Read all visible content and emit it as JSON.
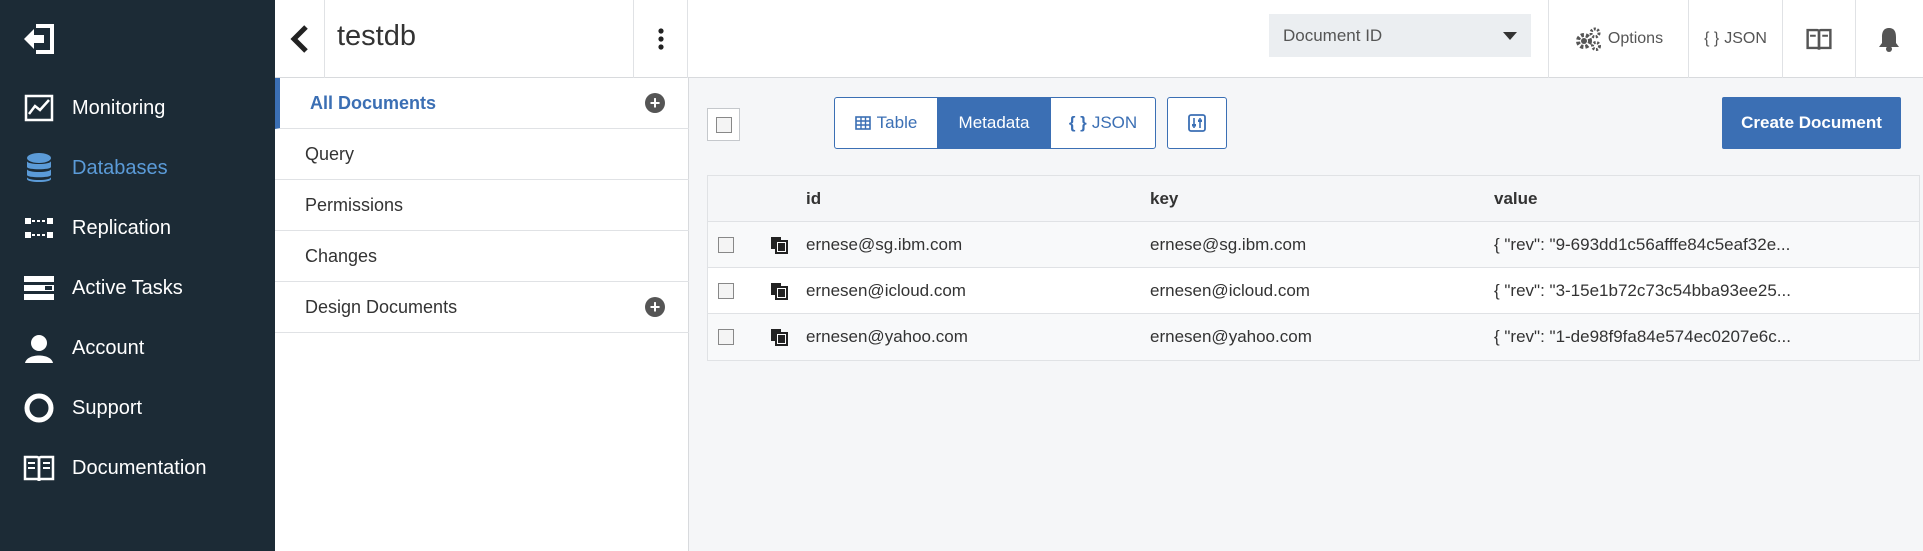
{
  "nav": {
    "items": [
      {
        "label": "Monitoring",
        "icon": "monitoring-icon"
      },
      {
        "label": "Databases",
        "icon": "database-icon",
        "active": true
      },
      {
        "label": "Replication",
        "icon": "replication-icon"
      },
      {
        "label": "Active Tasks",
        "icon": "tasks-icon"
      },
      {
        "label": "Account",
        "icon": "user-icon"
      },
      {
        "label": "Support",
        "icon": "lifebuoy-icon"
      },
      {
        "label": "Documentation",
        "icon": "book-icon"
      }
    ]
  },
  "header": {
    "title": "testdb",
    "select_value": "Document ID",
    "options_label": "Options",
    "json_label": "JSON"
  },
  "sidebar": {
    "items": [
      {
        "label": "All Documents",
        "active": true,
        "plus": true
      },
      {
        "label": "Query"
      },
      {
        "label": "Permissions"
      },
      {
        "label": "Changes"
      },
      {
        "label": "Design Documents",
        "plus": true
      }
    ]
  },
  "toolbar": {
    "views": [
      "Table",
      "Metadata",
      "JSON"
    ],
    "active_view": "Metadata",
    "create_label": "Create Document"
  },
  "table": {
    "columns": [
      "id",
      "key",
      "value"
    ],
    "rows": [
      {
        "id": "ernese@sg.ibm.com",
        "key": "ernese@sg.ibm.com",
        "value": "{ \"rev\": \"9-693dd1c56afffe84c5eaf32e..."
      },
      {
        "id": "ernesen@icloud.com",
        "key": "ernesen@icloud.com",
        "value": "{ \"rev\": \"3-15e1b72c73c54bba93ee25..."
      },
      {
        "id": "ernesen@yahoo.com",
        "key": "ernesen@yahoo.com",
        "value": "{ \"rev\": \"1-de98f9fa84e574ec0207e6c..."
      }
    ]
  }
}
